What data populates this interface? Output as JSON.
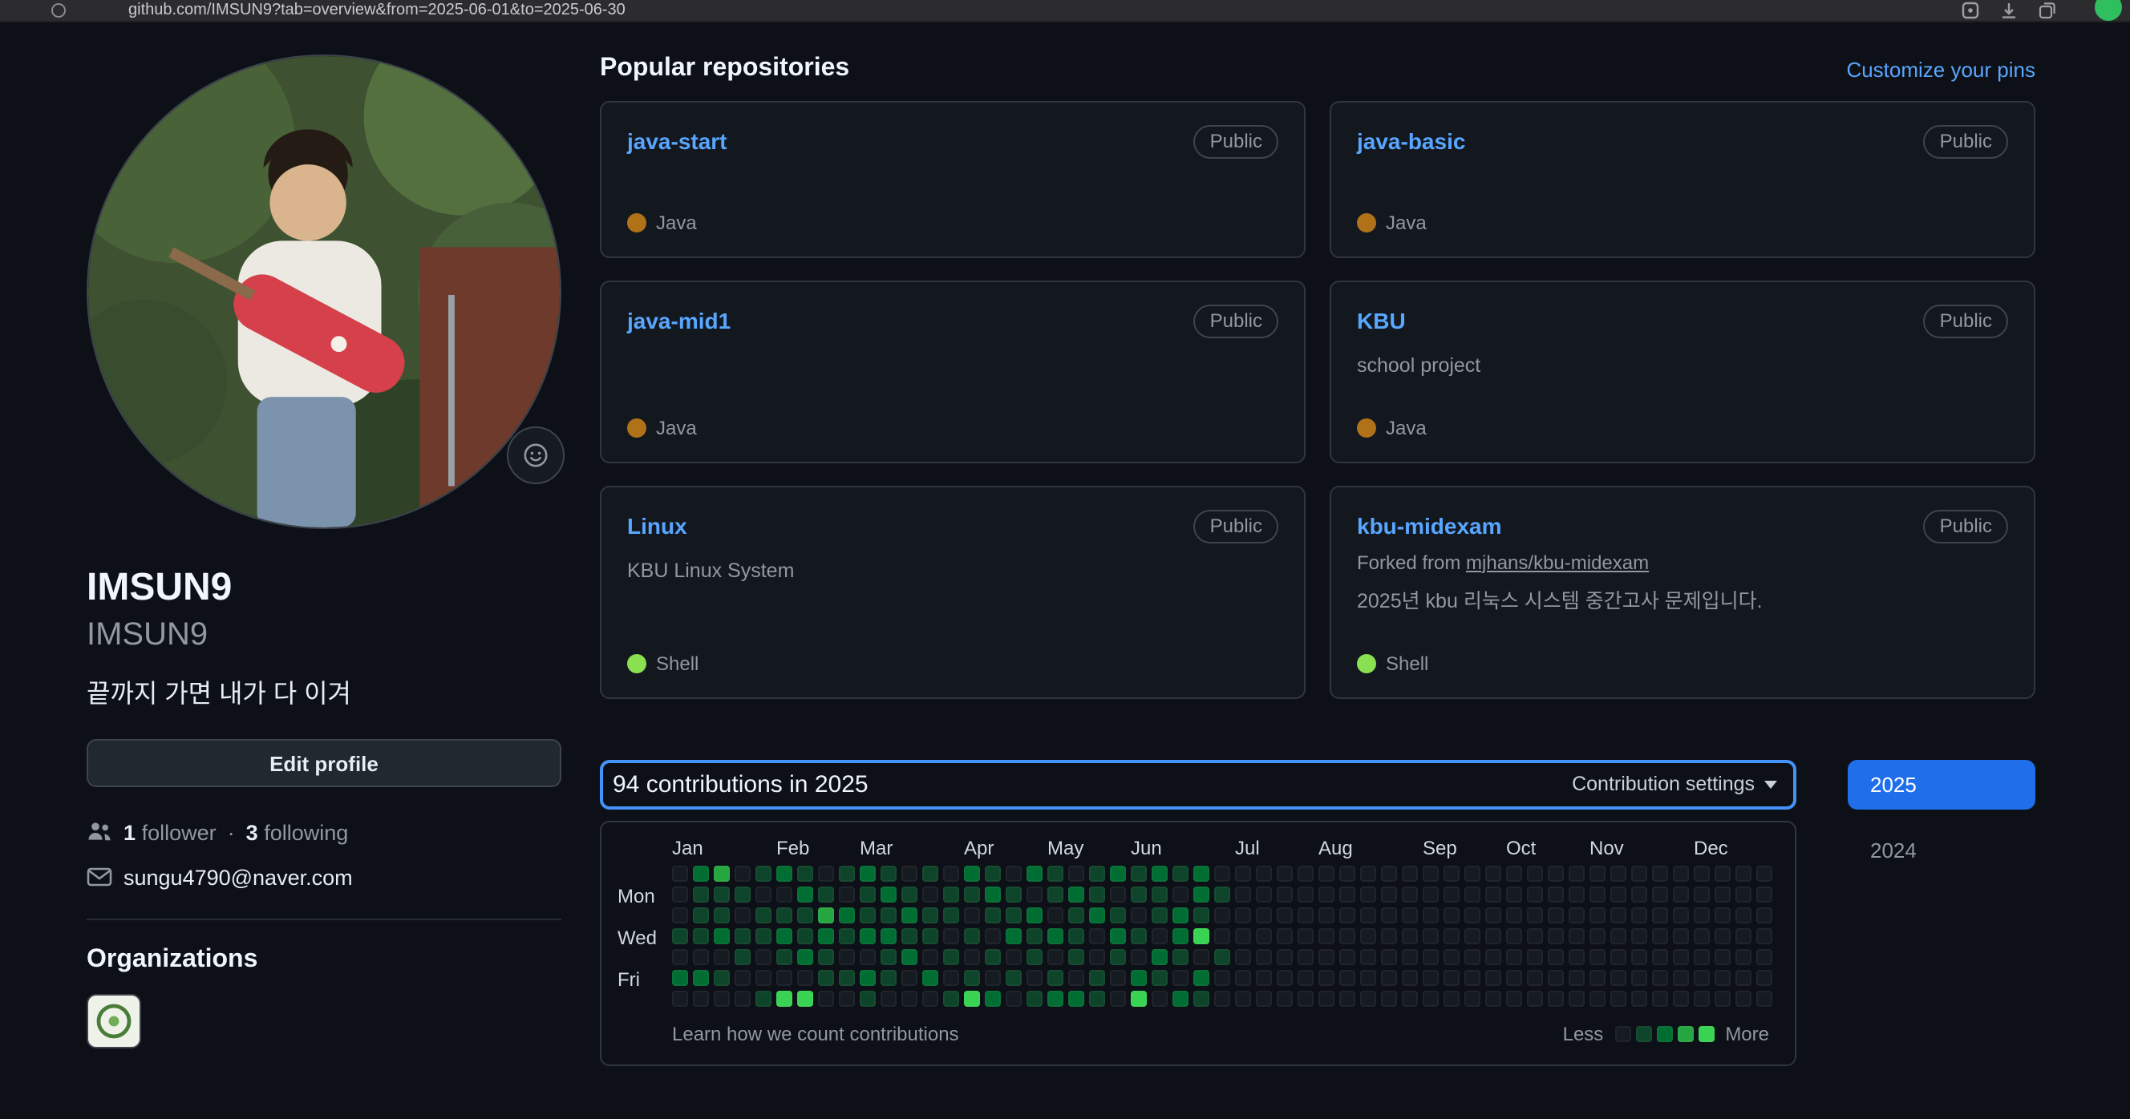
{
  "browser": {
    "url": "github.com/IMSUN9?tab=overview&from=2025-06-01&to=2025-06-30"
  },
  "profile": {
    "name": "IMSUN9",
    "username": "IMSUN9",
    "bio": "끝까지 가면 내가 다 이겨",
    "edit_button": "Edit profile",
    "followers_count": "1",
    "followers_label": "follower",
    "dot_separator": "·",
    "following_count": "3",
    "following_label": "following",
    "email": "sungu4790@naver.com",
    "organizations_title": "Organizations"
  },
  "main": {
    "popular_title": "Popular repositories",
    "customize_pins": "Customize your pins",
    "repos": [
      {
        "name": "java-start",
        "visibility": "Public",
        "description": "",
        "language": "Java",
        "language_color": "#b07219"
      },
      {
        "name": "java-basic",
        "visibility": "Public",
        "description": "",
        "language": "Java",
        "language_color": "#b07219"
      },
      {
        "name": "java-mid1",
        "visibility": "Public",
        "description": "",
        "language": "Java",
        "language_color": "#b07219"
      },
      {
        "name": "KBU",
        "visibility": "Public",
        "description": "school project",
        "language": "Java",
        "language_color": "#b07219"
      },
      {
        "name": "Linux",
        "visibility": "Public",
        "description": "KBU Linux System",
        "language": "Shell",
        "language_color": "#89e051"
      },
      {
        "name": "kbu-midexam",
        "visibility": "Public",
        "fork_prefix": "Forked from",
        "fork_link": "mjhans/kbu-midexam",
        "description": "2025년 kbu 리눅스 시스템 중간고사 문제입니다.",
        "language": "Shell",
        "language_color": "#89e051"
      }
    ],
    "contributions": {
      "title": "94 contributions in 2025",
      "settings_label": "Contribution settings",
      "footer_link": "Learn how we count contributions",
      "legend_less": "Less",
      "legend_more": "More",
      "level_colors": [
        "#161b22",
        "#0e4429",
        "#006d32",
        "#26a641",
        "#39d353"
      ],
      "months": [
        {
          "label": "Jan",
          "week": 0
        },
        {
          "label": "Feb",
          "week": 5
        },
        {
          "label": "Mar",
          "week": 9
        },
        {
          "label": "Apr",
          "week": 14
        },
        {
          "label": "May",
          "week": 18
        },
        {
          "label": "Jun",
          "week": 22
        },
        {
          "label": "Jul",
          "week": 27
        },
        {
          "label": "Aug",
          "week": 31
        },
        {
          "label": "Sep",
          "week": 36
        },
        {
          "label": "Oct",
          "week": 40
        },
        {
          "label": "Nov",
          "week": 44
        },
        {
          "label": "Dec",
          "week": 49
        }
      ],
      "day_labels": [
        {
          "label": "Mon",
          "row": 1
        },
        {
          "label": "Wed",
          "row": 3
        },
        {
          "label": "Fri",
          "row": 5
        }
      ],
      "weeks": [
        "0001020",
        "2111020",
        "3112010",
        "0101100",
        "1011001",
        "2012104",
        "1211204",
        "0132110",
        "1021010",
        "2112021",
        "1212110",
        "0121200",
        "1011020",
        "0110101",
        "2101014",
        "1210102",
        "0112010",
        "2021101",
        "1102012",
        "0211102",
        "1120011",
        "2012100",
        "1101024",
        "2110210",
        "1022102",
        "2214021",
        "0100100",
        "0000000",
        "0000000",
        "0000000",
        "0000000",
        "0000000",
        "0000000",
        "0000000",
        "0000000",
        "0000000",
        "0000000",
        "0000000",
        "0000000",
        "0000000",
        "0000000",
        "0000000",
        "0000000",
        "0000000",
        "0000000",
        "0000000",
        "0000000",
        "0000000",
        "0000000",
        "0000000",
        "0000000",
        "0000000",
        "0000000"
      ]
    },
    "years": [
      {
        "label": "2025",
        "active": true
      },
      {
        "label": "2024",
        "active": false
      }
    ]
  }
}
